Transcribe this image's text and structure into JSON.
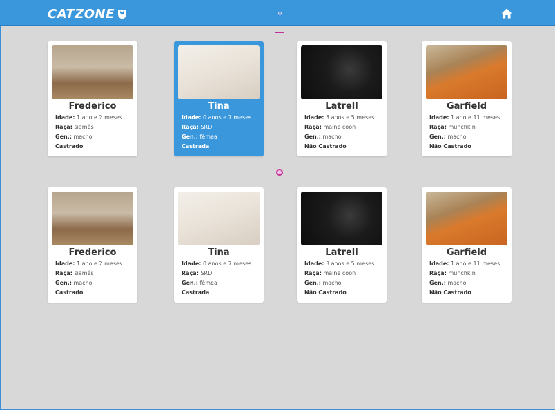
{
  "app": {
    "logo_text": "CATZONE"
  },
  "icons": {
    "logo_badge": "cat-shield-icon",
    "home": "home-icon"
  },
  "colors": {
    "topbar": "#3a97dc",
    "background": "#d8d8d8",
    "card_active": "#3a97dc",
    "indicator": "#c2339a"
  },
  "labels": {
    "age": "Idade:",
    "breed": "Raça:",
    "gender": "Gen.:"
  },
  "cards": [
    {
      "name": "Frederico",
      "age": "1 ano e 2 meses",
      "breed": "siamês",
      "gender": "macho",
      "status": "Castrado",
      "photo": "siamese-cat",
      "active": false
    },
    {
      "name": "Tina",
      "age": "0 anos e 7 meses",
      "breed": "SRD",
      "gender": "fêmea",
      "status": "Castrada",
      "photo": "calico-cat",
      "active": true
    },
    {
      "name": "Latrell",
      "age": "3 anos e 5 meses",
      "breed": "maine coon",
      "gender": "macho",
      "status": "Não Castrado",
      "photo": "black-cat",
      "active": false
    },
    {
      "name": "Garfield",
      "age": "1 ano e 11 meses",
      "breed": "munchkin",
      "gender": "macho",
      "status": "Não Castrado",
      "photo": "orange-cat",
      "active": false
    },
    {
      "name": "Frederico",
      "age": "1 ano e 2 meses",
      "breed": "siamês",
      "gender": "macho",
      "status": "Castrado",
      "photo": "siamese-cat",
      "active": false
    },
    {
      "name": "Tina",
      "age": "0 anos e 7 meses",
      "breed": "SRD",
      "gender": "fêmea",
      "status": "Castrada",
      "photo": "calico-cat",
      "active": false
    },
    {
      "name": "Latrell",
      "age": "3 anos e 5 meses",
      "breed": "maine coon",
      "gender": "macho",
      "status": "Não Castrado",
      "photo": "black-cat",
      "active": false
    },
    {
      "name": "Garfield",
      "age": "1 ano e 11 meses",
      "breed": "munchkin",
      "gender": "macho",
      "status": "Não Castrado",
      "photo": "orange-cat",
      "active": false
    }
  ]
}
